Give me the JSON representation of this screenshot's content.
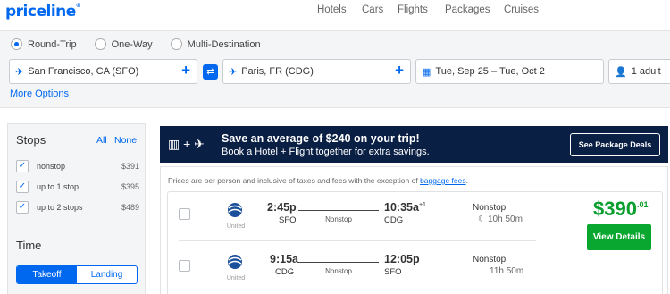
{
  "header": {
    "logo": "priceline",
    "nav": [
      "Hotels",
      "Cars",
      "Flights",
      "Packages",
      "Cruises"
    ]
  },
  "search": {
    "trip_types": [
      "Round-Trip",
      "One-Way",
      "Multi-Destination"
    ],
    "selected_trip_type": "Round-Trip",
    "origin": "San Francisco, CA (SFO)",
    "destination": "Paris, FR (CDG)",
    "dates": "Tue, Sep 25 – Tue, Oct 2",
    "travelers": "1 adult",
    "more_options": "More Options"
  },
  "filters": {
    "stops_title": "Stops",
    "all_link": "All",
    "none_link": "None",
    "stops": [
      {
        "label": "nonstop",
        "price": "$391",
        "checked": true
      },
      {
        "label": "up to 1 stop",
        "price": "$395",
        "checked": true
      },
      {
        "label": "up to 2 stops",
        "price": "$489",
        "checked": true
      }
    ],
    "time_title": "Time",
    "time_tabs": [
      "Takeoff",
      "Landing"
    ],
    "time_selected": "Takeoff"
  },
  "banner": {
    "headline": "Save an average of $240 on your trip!",
    "subline": "Book a Hotel + Flight together for extra savings.",
    "button": "See Package Deals"
  },
  "results": {
    "note_prefix": "Prices are per person and inclusive of taxes and fees with the exception of ",
    "note_link": "baggage fees",
    "note_suffix": ".",
    "itinerary": {
      "airline": "United",
      "price_dollars": "$390",
      "price_cents": ".01",
      "cta": "View Details",
      "legs": [
        {
          "depart_time": "2:45p",
          "depart_airport": "SFO",
          "arrive_time": "10:35a",
          "arrive_sup": "+1",
          "arrive_airport": "CDG",
          "stops": "Nonstop",
          "mid_label": "Nonstop",
          "duration": "10h 50m",
          "overnight": true
        },
        {
          "depart_time": "9:15a",
          "depart_airport": "CDG",
          "arrive_time": "12:05p",
          "arrive_sup": "",
          "arrive_airport": "SFO",
          "stops": "Nonstop",
          "mid_label": "Nonstop",
          "duration": "11h 50m",
          "overnight": false
        }
      ]
    }
  },
  "colors": {
    "brand": "#0068ef",
    "banner_bg": "#0a1f44",
    "price_green": "#0a9e2e",
    "cta_green": "#0aa730"
  }
}
